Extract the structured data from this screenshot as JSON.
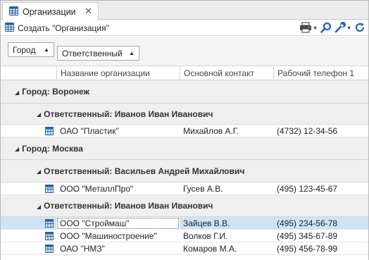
{
  "tab": {
    "label": "Организации",
    "close": "✕"
  },
  "toolbar": {
    "create_label": "Создать \"Организация\""
  },
  "group_panel": {
    "chips": [
      {
        "label": "Город",
        "sort": "▲"
      },
      {
        "label": "Ответственный",
        "sort": "▲"
      }
    ]
  },
  "columns": [
    "Название организации",
    "Основной контакт",
    "Рабочий телефон 1"
  ],
  "groups": [
    {
      "label": "Город: Воронеж",
      "subgroups": [
        {
          "label": "Ответственный: Иванов Иван Иванович",
          "rows": [
            {
              "name": "ОАО \"Пластик\"",
              "contact": "Михайлов А.Г.",
              "phone": "(4732) 12-34-56"
            }
          ]
        }
      ]
    },
    {
      "label": "Город: Москва",
      "subgroups": [
        {
          "label": "Ответственный: Васильев Андрей Михайлович",
          "rows": [
            {
              "name": "ООО \"МеталлПро\"",
              "contact": "Гусев А.В.",
              "phone": "(495) 123-45-67"
            }
          ]
        },
        {
          "label": "Ответственный: Иванов Иван Иванович",
          "rows": [
            {
              "name": "ООО \"Строймаш\"",
              "contact": "Зайцев В.В.",
              "phone": "(495) 234-56-78",
              "selected": true
            },
            {
              "name": "ООО \"Машиностроение\"",
              "contact": "Волков Г.И.",
              "phone": "(495) 345-67-89"
            },
            {
              "name": "ОАО \"НМЗ\"",
              "contact": "Комаров М.А.",
              "phone": "(495) 456-78-99"
            }
          ]
        }
      ]
    }
  ],
  "icons": {
    "tab": "table-icon",
    "create": "table-icon",
    "print": "printer-icon",
    "search": "search-icon",
    "settings": "wrench-icon",
    "refresh": "refresh-icon",
    "row": "table-icon"
  },
  "colors": {
    "selection": "#cde4f7",
    "accent": "#1c62b5",
    "group_bg": "#efefef"
  }
}
